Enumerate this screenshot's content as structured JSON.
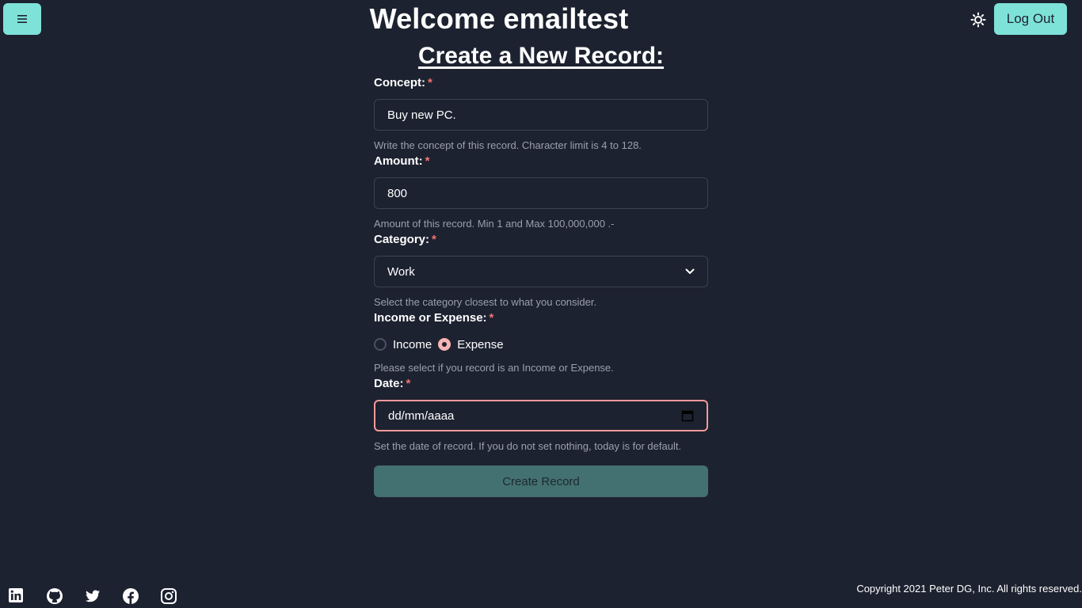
{
  "header": {
    "welcome": "Welcome emailtest",
    "logout_label": "Log Out",
    "menu_icon": "hamburger-icon",
    "theme_icon": "sun-icon",
    "accent_color": "#7ee2d8"
  },
  "form": {
    "title": "Create a New Record:",
    "required_mark": "*",
    "concept": {
      "label": "Concept:",
      "value": "Buy new PC.",
      "help": "Write the concept of this record. Character limit is 4 to 128."
    },
    "amount": {
      "label": "Amount:",
      "value": "800",
      "help": "Amount of this record. Min 1 and Max 100,000,000 .-"
    },
    "category": {
      "label": "Category:",
      "value": "Work",
      "help": "Select the category closest to what you consider."
    },
    "type": {
      "label": "Income or Expense:",
      "options": [
        "Income",
        "Expense"
      ],
      "selected": "Expense",
      "help": "Please select if you record is an Income or Expense."
    },
    "date": {
      "label": "Date:",
      "placeholder": "dd/mm/aaaa",
      "help": "Set the date of record. If you do not set nothing, today is for default."
    },
    "submit_label": "Create Record"
  },
  "footer": {
    "social_icons": [
      "linkedin-icon",
      "github-icon",
      "twitter-icon",
      "facebook-icon",
      "instagram-icon"
    ],
    "copyright": "Copyright 2021 Peter DG, Inc. All rights reserved."
  }
}
